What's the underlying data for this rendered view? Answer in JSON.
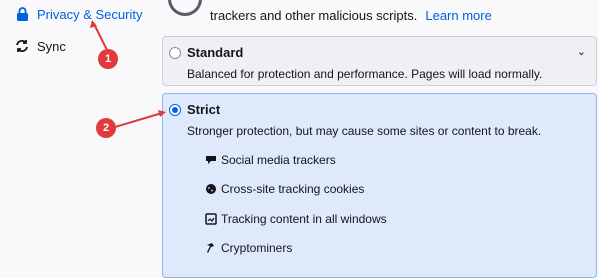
{
  "sidebar": {
    "items": [
      {
        "label": "Privacy & Security",
        "icon": "lock-icon",
        "active": true
      },
      {
        "label": "Sync",
        "icon": "sync-icon",
        "active": false
      }
    ]
  },
  "main": {
    "tracker_text": "trackers and other malicious scripts.",
    "learn_more": "Learn more",
    "standard": {
      "title": "Standard",
      "description": "Balanced for protection and performance. Pages will load normally."
    },
    "strict": {
      "title": "Strict",
      "description": "Stronger protection, but may cause some sites or content to break.",
      "features": [
        {
          "label": "Social media trackers",
          "icon": "social-tracker-icon"
        },
        {
          "label": "Cross-site tracking cookies",
          "icon": "cookie-icon"
        },
        {
          "label": "Tracking content in all windows",
          "icon": "tracking-content-icon"
        },
        {
          "label": "Cryptominers",
          "icon": "cryptominer-icon"
        }
      ]
    }
  },
  "annotations": [
    "1",
    "2"
  ],
  "colors": {
    "accent": "#0061e0",
    "selected_bg": "#deeafc",
    "annotation": "#e03a3a"
  }
}
